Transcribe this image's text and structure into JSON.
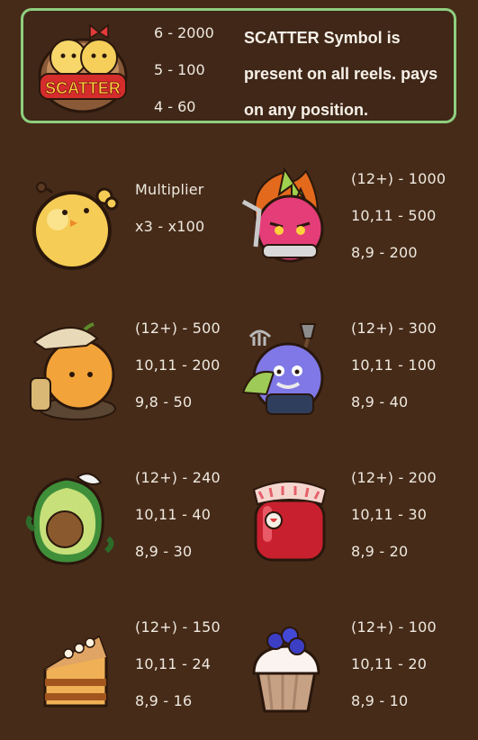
{
  "scatter": {
    "icon": "scatter-symbol-icon",
    "logo_text": "SCATTER",
    "pays": [
      "6 - 2000",
      "5 - 100",
      "4 - 60"
    ],
    "description": [
      "SCATTER Symbol is",
      "present on all reels. pays",
      "on any position."
    ]
  },
  "symbols": [
    {
      "icon": "chick-bomb-multiplier-icon",
      "lines": [
        "Multiplier",
        "x3 - x100"
      ]
    },
    {
      "icon": "dragon-fruit-monster-icon",
      "lines": [
        "(12+) - 1000",
        "10,11 - 500",
        "8,9 - 200"
      ]
    },
    {
      "icon": "onion-chick-farmer-icon",
      "lines": [
        "(12+) - 500",
        "10,11 - 200",
        "9,8 - 50"
      ]
    },
    {
      "icon": "blueberry-farmer-icon",
      "lines": [
        "(12+) - 300",
        "10,11 - 100",
        "8,9 - 40"
      ]
    },
    {
      "icon": "avocado-icon",
      "lines": [
        "(12+) - 240",
        "10,11 - 40",
        "8,9 - 30"
      ]
    },
    {
      "icon": "strawberry-jam-jar-icon",
      "lines": [
        "(12+) - 200",
        "10,11 - 30",
        "8,9 - 20"
      ]
    },
    {
      "icon": "cake-slice-icon",
      "lines": [
        "(12+) - 150",
        "10,11 - 24",
        "8,9 - 16"
      ]
    },
    {
      "icon": "blueberry-cupcake-icon",
      "lines": [
        "(12+) - 100",
        "10,11 - 20",
        "8,9 - 10"
      ]
    }
  ]
}
